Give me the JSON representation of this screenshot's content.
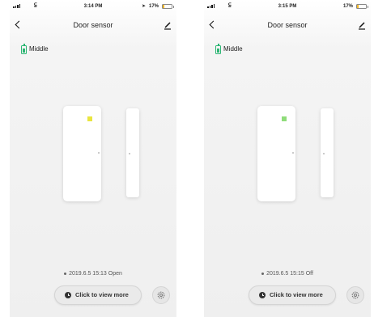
{
  "screens": [
    {
      "status": {
        "time": "3:14 PM",
        "battery_pct": "17%",
        "location_icon": "location-arrow-icon",
        "battery_level": 0.17
      },
      "nav": {
        "title": "Door sensor",
        "back_icon": "chevron-left-icon",
        "edit_icon": "pencil-icon"
      },
      "battery": {
        "label": "Middle",
        "icon": "battery-icon"
      },
      "sensor": {
        "led_color": "#e9e53f"
      },
      "event": {
        "text": "2019.6.5 15:13 Open"
      },
      "view_more": {
        "label": "Click to view more",
        "icon": "clock-icon"
      },
      "settings": {
        "icon": "gear-icon"
      }
    },
    {
      "status": {
        "time": "3:15 PM",
        "battery_pct": "17%",
        "battery_level": 0.17
      },
      "nav": {
        "title": "Door sensor",
        "back_icon": "chevron-left-icon",
        "edit_icon": "pencil-icon"
      },
      "battery": {
        "label": "Middle",
        "icon": "battery-icon"
      },
      "sensor": {
        "led_color": "#8fdc7a"
      },
      "event": {
        "text": "2019.6.5 15:15 Off"
      },
      "view_more": {
        "label": "Click to view more",
        "icon": "clock-icon"
      },
      "settings": {
        "icon": "gear-icon"
      }
    }
  ],
  "colors": {
    "battery_green": "#2bb673",
    "status_battery": "#f2b829"
  }
}
